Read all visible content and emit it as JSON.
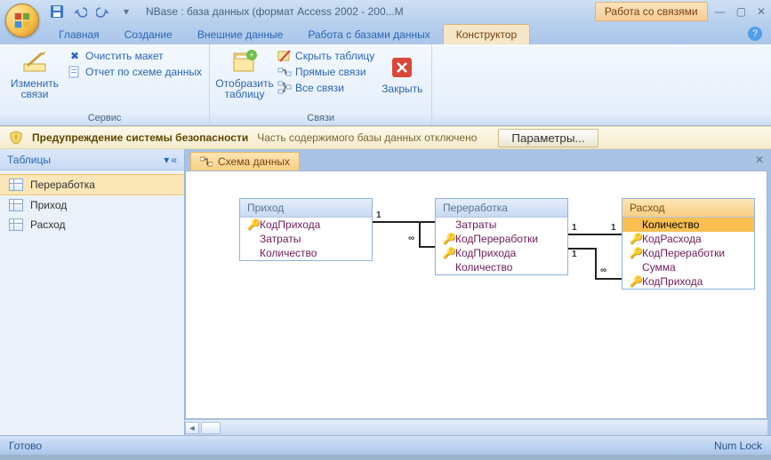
{
  "titlebar": {
    "app_title": "NBase : база данных (формат Access 2002 - 200...М",
    "context_tab": "Работа со связями"
  },
  "tabs": {
    "home": "Главная",
    "create": "Создание",
    "external": "Внешние данные",
    "dbtools": "Работа с базами данных",
    "designer": "Конструктор"
  },
  "ribbon": {
    "group_service": "Сервис",
    "group_links": "Связи",
    "edit_links": "Изменить\nсвязи",
    "clear_layout": "Очистить макет",
    "schema_report": "Отчет по схеме данных",
    "show_table": "Отобразить\nтаблицу",
    "hide_table": "Скрыть таблицу",
    "direct_links": "Прямые связи",
    "all_links": "Все связи",
    "close": "Закрыть"
  },
  "security": {
    "title": "Предупреждение системы безопасности",
    "message": "Часть содержимого базы данных отключено",
    "button": "Параметры..."
  },
  "nav": {
    "header": "Таблицы",
    "items": [
      {
        "label": "Переработка"
      },
      {
        "label": "Приход"
      },
      {
        "label": "Расход"
      }
    ]
  },
  "doc": {
    "tab": "Схема данных"
  },
  "tables": {
    "t1": {
      "title": "Приход",
      "fields": [
        {
          "key": true,
          "name": "КодПрихода"
        },
        {
          "key": false,
          "name": "Затраты"
        },
        {
          "key": false,
          "name": "Количество"
        }
      ]
    },
    "t2": {
      "title": "Переработка",
      "fields": [
        {
          "key": false,
          "name": "Затраты"
        },
        {
          "key": true,
          "name": "КодПереработки"
        },
        {
          "key": true,
          "name": "КодПрихода"
        },
        {
          "key": false,
          "name": "Количество"
        }
      ]
    },
    "t3": {
      "title": "Расход",
      "fields": [
        {
          "key": false,
          "name": "Количество",
          "sel": true
        },
        {
          "key": true,
          "name": "КодРасхода"
        },
        {
          "key": true,
          "name": "КодПереработки"
        },
        {
          "key": false,
          "name": "Сумма"
        },
        {
          "key": true,
          "name": "КодПрихода"
        }
      ]
    }
  },
  "rel_labels": {
    "one": "1",
    "many": "∞"
  },
  "status": {
    "ready": "Готово",
    "numlock": "Num Lock"
  }
}
